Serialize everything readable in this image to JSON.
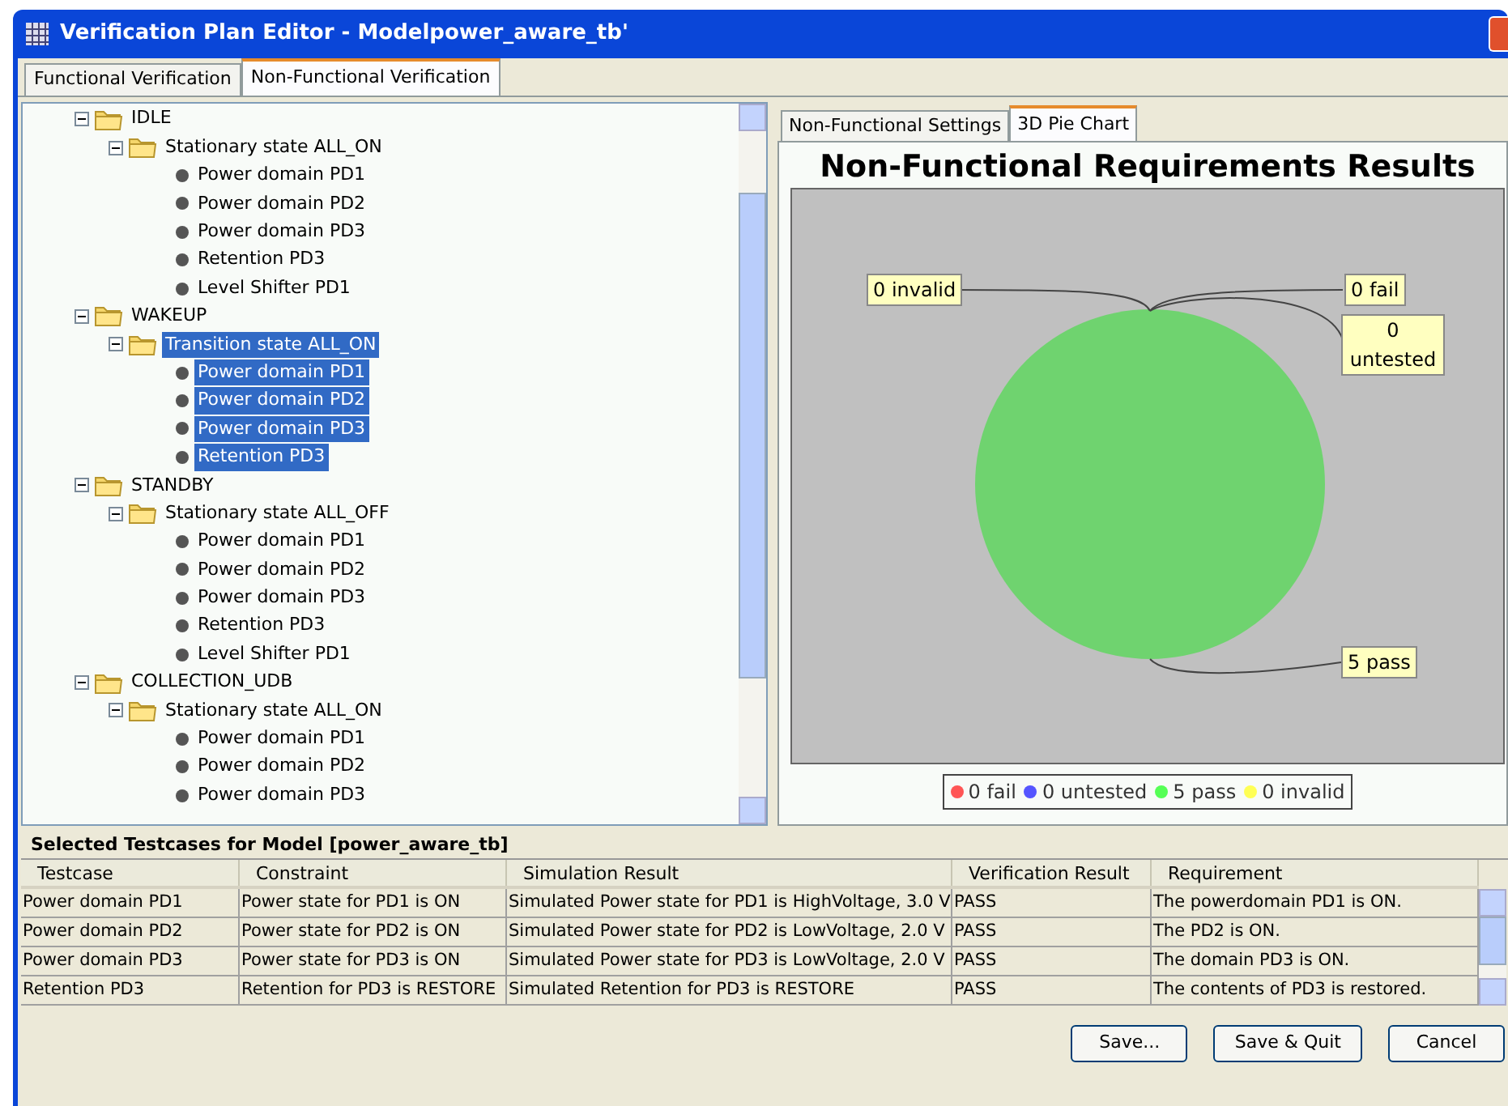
{
  "window": {
    "title": "Verification Plan Editor - Modelpower_aware_tb'"
  },
  "tabs": [
    {
      "label": "Functional Verification",
      "selected": false
    },
    {
      "label": "Non-Functional Verification",
      "selected": true
    }
  ],
  "tree": [
    {
      "label": "IDLE",
      "expanded": true,
      "selected": false,
      "children": [
        {
          "label": "Stationary state ALL_ON",
          "expanded": true,
          "selected": false,
          "children": [
            {
              "label": "Power domain PD1",
              "selected": false
            },
            {
              "label": "Power domain PD2",
              "selected": false
            },
            {
              "label": "Power domain PD3",
              "selected": false
            },
            {
              "label": "Retention PD3",
              "selected": false
            },
            {
              "label": "Level Shifter PD1",
              "selected": false
            }
          ]
        }
      ]
    },
    {
      "label": "WAKEUP",
      "expanded": true,
      "selected": false,
      "children": [
        {
          "label": "Transition state ALL_ON",
          "expanded": true,
          "selected": true,
          "children": [
            {
              "label": "Power domain PD1",
              "selected": true
            },
            {
              "label": "Power domain PD2",
              "selected": true
            },
            {
              "label": "Power domain PD3",
              "selected": true
            },
            {
              "label": "Retention PD3",
              "selected": true
            }
          ]
        }
      ]
    },
    {
      "label": "STANDBY",
      "expanded": true,
      "selected": false,
      "children": [
        {
          "label": "Stationary state ALL_OFF",
          "expanded": true,
          "selected": false,
          "children": [
            {
              "label": "Power domain PD1",
              "selected": false
            },
            {
              "label": "Power domain PD2",
              "selected": false
            },
            {
              "label": "Power domain PD3",
              "selected": false
            },
            {
              "label": "Retention PD3",
              "selected": false
            },
            {
              "label": "Level Shifter PD1",
              "selected": false
            }
          ]
        }
      ]
    },
    {
      "label": "COLLECTION_UDB",
      "expanded": true,
      "selected": false,
      "children": [
        {
          "label": "Stationary state ALL_ON",
          "expanded": true,
          "selected": false,
          "children": [
            {
              "label": "Power domain PD1",
              "selected": false
            },
            {
              "label": "Power domain PD2",
              "selected": false
            },
            {
              "label": "Power domain PD3",
              "selected": false
            }
          ]
        }
      ]
    }
  ],
  "right_tabs": [
    {
      "label": "Non-Functional Settings",
      "selected": false
    },
    {
      "label": "3D Pie Chart",
      "selected": true
    }
  ],
  "chart": {
    "legend": [
      {
        "label": "0 fail",
        "color": "#ff5555"
      },
      {
        "label": "0 untested",
        "color": "#5555ff"
      },
      {
        "label": "5 pass",
        "color": "#55ff55"
      },
      {
        "label": "0 invalid",
        "color": "#ffff55"
      }
    ],
    "chart_data": {
      "type": "pie",
      "title": "Non-Functional Requirements Results",
      "categories": [
        "0 invalid",
        "0 fail",
        "0 untested",
        "5 pass"
      ],
      "series": [
        {
          "color": "#6fd36f",
          "values": [
            0,
            0,
            0,
            5
          ]
        }
      ]
    }
  },
  "testcases": {
    "title": "Selected Testcases for Model [power_aware_tb]",
    "columns": [
      "Testcase",
      "Constraint",
      "Simulation Result",
      "Verification Result",
      "Requirement"
    ],
    "rows": [
      [
        "Power domain PD1",
        "Power state for PD1 is ON",
        "Simulated Power state for PD1 is HighVoltage, 3.0 V",
        "PASS",
        "The powerdomain PD1 is ON."
      ],
      [
        "Power domain PD2",
        "Power state for PD2 is ON",
        "Simulated Power state for PD2 is LowVoltage, 2.0 V",
        "PASS",
        "The PD2 is ON."
      ],
      [
        "Power domain PD3",
        "Power state for PD3 is ON",
        "Simulated Power state for PD3 is LowVoltage, 2.0 V",
        "PASS",
        "The domain PD3 is ON."
      ],
      [
        "Retention PD3",
        "Retention for PD3 is RESTORE",
        "Simulated Retention for PD3 is RESTORE",
        "PASS",
        "The contents of PD3 is restored."
      ]
    ]
  },
  "buttons": [
    "Save...",
    "Save & Quit",
    "Cancel"
  ]
}
